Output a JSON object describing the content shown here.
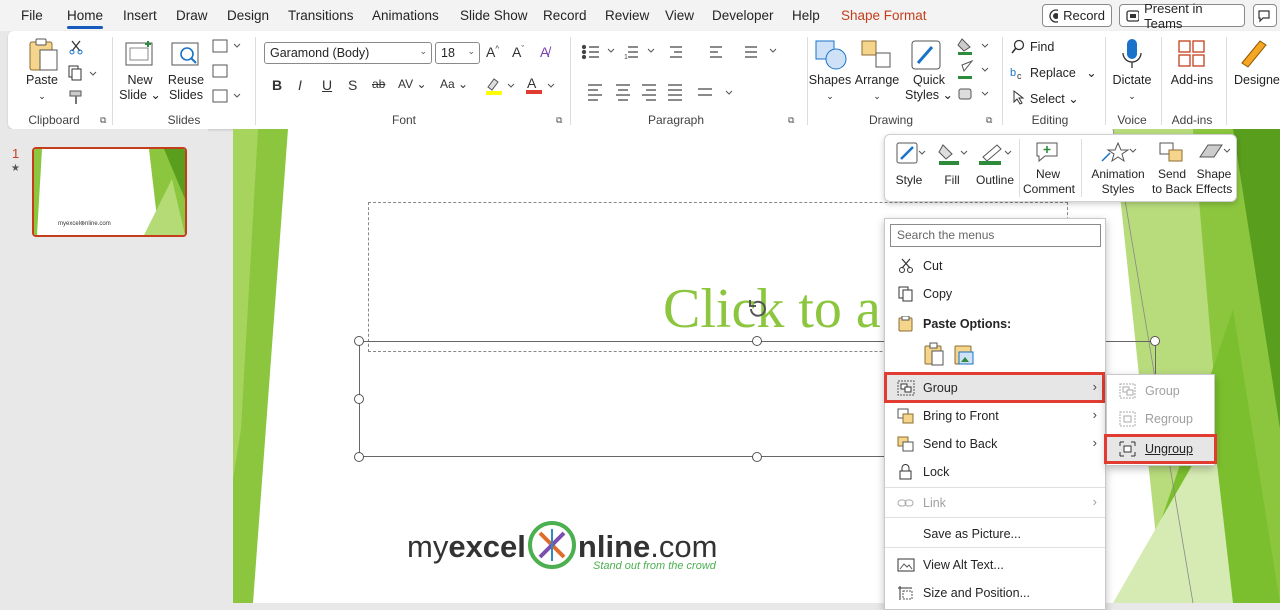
{
  "menu_tabs": [
    "File",
    "Home",
    "Insert",
    "Draw",
    "Design",
    "Transitions",
    "Animations",
    "Slide Show",
    "Record",
    "Review",
    "View",
    "Developer",
    "Help",
    "Shape Format"
  ],
  "top_buttons": {
    "record": "Record",
    "present": "Present in Teams"
  },
  "ribbon": {
    "clipboard": {
      "paste": "Paste",
      "label": "Clipboard"
    },
    "slides": {
      "new_slide_1": "New",
      "new_slide_2": "Slide",
      "reuse_1": "Reuse",
      "reuse_2": "Slides",
      "label": "Slides"
    },
    "font": {
      "family": "Garamond (Body)",
      "size": "18",
      "label": "Font"
    },
    "paragraph": {
      "label": "Paragraph"
    },
    "drawing": {
      "shapes": "Shapes",
      "arrange": "Arrange",
      "quick_1": "Quick",
      "quick_2": "Styles",
      "label": "Drawing"
    },
    "editing": {
      "find": "Find",
      "replace": "Replace",
      "select": "Select",
      "label": "Editing"
    },
    "voice": {
      "dictate": "Dictate",
      "label": "Voice"
    },
    "addins": {
      "addins": "Add-ins",
      "label": "Add-ins"
    },
    "designer": {
      "label": "Designer"
    }
  },
  "thumbnail": {
    "number": "1",
    "star": "★"
  },
  "slide": {
    "title_text": "Click to a",
    "logo_my": "my",
    "logo_excel": "excel",
    "logo_nline": "nline",
    "logo_com": ".com",
    "logo_tag": "Stand out from the crowd"
  },
  "mini_toolbar": {
    "style": "Style",
    "fill": "Fill",
    "outline": "Outline",
    "new_comment_1": "New",
    "new_comment_2": "Comment",
    "anim_1": "Animation",
    "anim_2": "Styles",
    "send_1": "Send",
    "send_2": "to Back",
    "effects_1": "Shape",
    "effects_2": "Effects"
  },
  "context_menu": {
    "search_placeholder": "Search the menus",
    "cut": "Cut",
    "copy": "Copy",
    "paste_options": "Paste Options:",
    "group": "Group",
    "bring_front": "Bring to Front",
    "send_back": "Send to Back",
    "lock": "Lock",
    "link": "Link",
    "save_picture": "Save as Picture...",
    "alt_text": "View Alt Text...",
    "size_position": "Size and Position..."
  },
  "submenu": {
    "group": "Group",
    "regroup": "Regroup",
    "ungroup": "Ungroup"
  },
  "colors": {
    "accent": "#185abd",
    "highlight": "#e03c31",
    "shape_format": "#c43e1c",
    "green": "#8cc63f"
  }
}
